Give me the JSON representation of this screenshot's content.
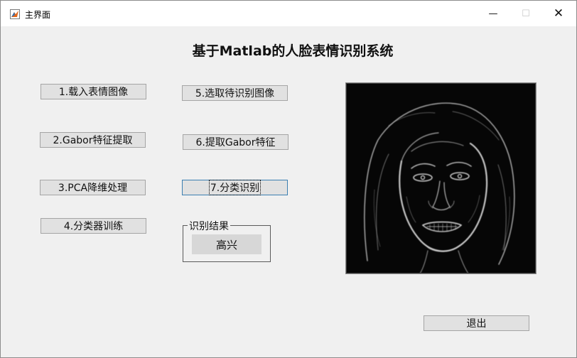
{
  "window": {
    "title": "主界面",
    "controls": {
      "minimize": "—",
      "maximize": "☐",
      "close": "✕"
    }
  },
  "heading": "基于Matlab的人脸表情识别系统",
  "buttons": {
    "load_expression": "1.载入表情图像",
    "gabor_extract": "2.Gabor特征提取",
    "pca_reduce": "3.PCA降维处理",
    "train_classifier": "4.分类器训练",
    "select_image": "5.选取待识别图像",
    "extract_gabor": "6.提取Gabor特征",
    "classify": "7.分类识别",
    "exit": "退出"
  },
  "result_group": {
    "label": "识别结果",
    "value": "高兴"
  },
  "image_panel": {
    "icon": "face-edge-image"
  }
}
